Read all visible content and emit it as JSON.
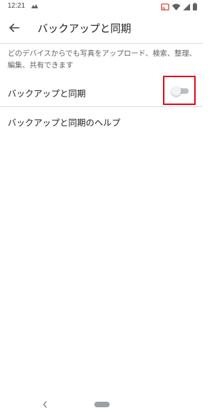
{
  "status_bar": {
    "time": "12:21",
    "icons": [
      "notification-app-icon",
      "cast-icon",
      "wifi-icon",
      "cell-signal-icon",
      "battery-icon"
    ]
  },
  "app_bar": {
    "back_icon": "arrow-back-icon",
    "title": "バックアップと同期"
  },
  "description": "どのデバイスからでも写真をアップロード、検索、整理、編集、共有できます",
  "settings": {
    "backup_sync": {
      "label": "バックアップと同期",
      "enabled": false
    },
    "help_label": "バックアップと同期のヘルプ"
  },
  "colors": {
    "highlight": "#e60012",
    "divider": "#dadce0",
    "toggle_track_off": "#bdc1c6",
    "toggle_thumb_off": "#f1f3f4",
    "text_primary": "#202124",
    "text_secondary": "#5f6368"
  },
  "nav_bar": {
    "icons": [
      "nav-back-icon",
      "home-pill-icon"
    ]
  }
}
